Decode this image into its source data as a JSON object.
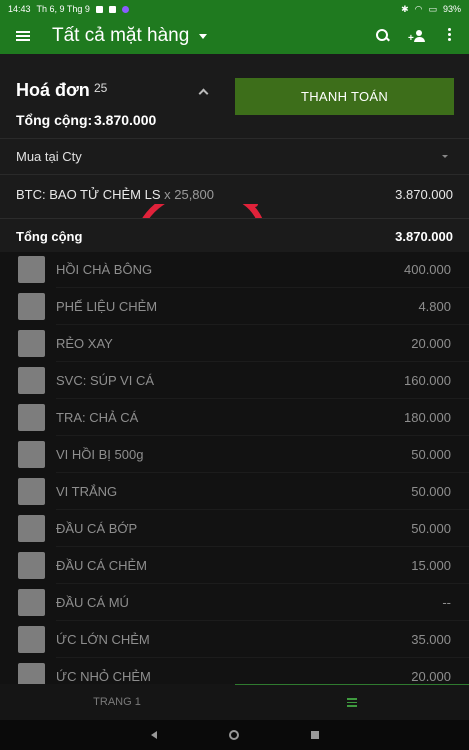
{
  "status_bar": {
    "time": "14:43",
    "date": "Th 6, 9 Thg 9",
    "battery": "93%"
  },
  "header": {
    "title": "Tất cả mặt hàng",
    "icons": [
      "menu-icon",
      "search-icon",
      "add-user-icon",
      "more-icon"
    ]
  },
  "invoice": {
    "title": "Hoá đơn",
    "count": "25",
    "total_label": "Tổng cộng:",
    "total_value": "3.870.000",
    "pay_button": "THANH TOÁN",
    "location": "Mua tại Cty",
    "line_item": {
      "name": "BTC: BAO TỬ CHẺM LS",
      "qty": "x 25,800",
      "value": "3.870.000"
    },
    "summary_label": "Tổng cộng",
    "summary_value": "3.870.000"
  },
  "products": [
    {
      "name": "HỒI CHÀ BÔNG",
      "price": "400.000"
    },
    {
      "name": "PHẾ LIỆU CHẺM",
      "price": "4.800"
    },
    {
      "name": "RẺO XAY",
      "price": "20.000"
    },
    {
      "name": "SVC: SÚP VI CÁ",
      "price": "160.000"
    },
    {
      "name": "TRA: CHẢ CÁ",
      "price": "180.000"
    },
    {
      "name": "VI HỒI BỊ 500g",
      "price": "50.000"
    },
    {
      "name": "VI TRẮNG",
      "price": "50.000"
    },
    {
      "name": "ĐẦU CÁ BỚP",
      "price": "50.000"
    },
    {
      "name": "ĐẦU CÁ CHẺM",
      "price": "15.000"
    },
    {
      "name": "ĐẦU CÁ MÚ",
      "price": "--"
    },
    {
      "name": "ỨC LỚN CHẺM",
      "price": "35.000"
    },
    {
      "name": "ỨC NHỎ CHẺM",
      "price": "20.000"
    }
  ],
  "bottom_tabs": {
    "page_label": "TRANG 1",
    "list_icon": "list-icon"
  },
  "colors": {
    "appbar": "#1f7a1f",
    "pay_button": "#3d6e1a",
    "annotation": "#e0223a"
  }
}
